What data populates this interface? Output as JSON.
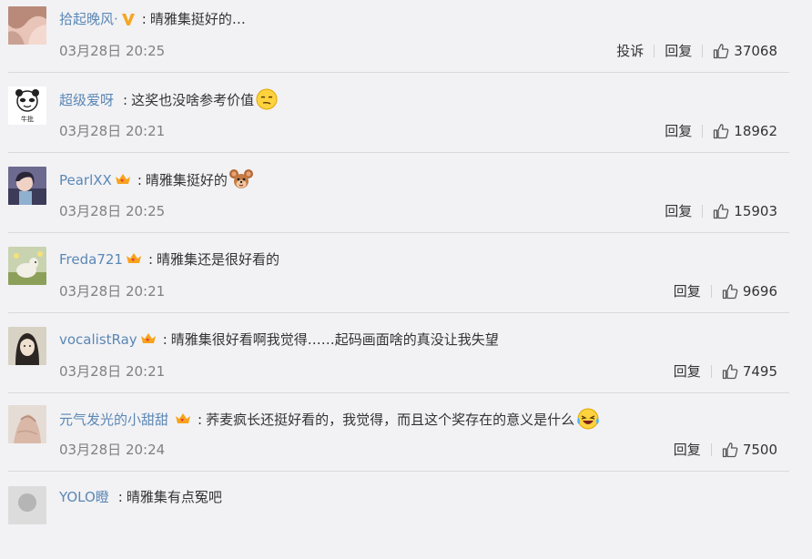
{
  "comments": [
    {
      "username": "拾起晚风·",
      "badge": "vip-v-icon",
      "content": "晴雅集挺好的…",
      "emoji": "",
      "time": "03月28日 20:25",
      "report": "投诉",
      "reply": "回复",
      "likes": "37068"
    },
    {
      "username": "超级爱呀",
      "badge": "",
      "content": "这奖也没啥参考价值",
      "emoji": "smirk-emoji-icon",
      "time": "03月28日 20:21",
      "report": "",
      "reply": "回复",
      "likes": "18962"
    },
    {
      "username": "PearlXX",
      "badge": "crown-heart-icon",
      "content": "晴雅集挺好的",
      "emoji": "mouse-face-icon",
      "time": "03月28日 20:25",
      "report": "",
      "reply": "回复",
      "likes": "15903"
    },
    {
      "username": "Freda721",
      "badge": "crown-heart-icon",
      "content": "晴雅集还是很好看的",
      "emoji": "",
      "time": "03月28日 20:21",
      "report": "",
      "reply": "回复",
      "likes": "9696"
    },
    {
      "username": "vocalistRay",
      "badge": "crown-heart-icon",
      "content": "晴雅集很好看啊我觉得……起码画面啥的真没让我失望",
      "emoji": "",
      "time": "03月28日 20:21",
      "report": "",
      "reply": "回复",
      "likes": "7495"
    },
    {
      "username": "元气发光的小甜甜",
      "badge": "crown-heart-icon",
      "content": "荞麦疯长还挺好看的，我觉得，而且这个奖存在的意义是什么",
      "emoji": "laugh-cry-emoji-icon",
      "time": "03月28日 20:24",
      "report": "",
      "reply": "回复",
      "likes": "7500"
    },
    {
      "username": "YOLO瞪",
      "badge": "",
      "content": "晴雅集有点冤吧",
      "emoji": "",
      "time": "",
      "report": "",
      "reply": "",
      "likes": ""
    }
  ],
  "colors": {
    "background": "#f2f2f5",
    "username": "#5b87b4",
    "text": "#333333",
    "time": "#808080",
    "vip": "#f5a623",
    "crown": "#f7a31c"
  },
  "avatar_captions": {
    "row2": "牛批"
  }
}
